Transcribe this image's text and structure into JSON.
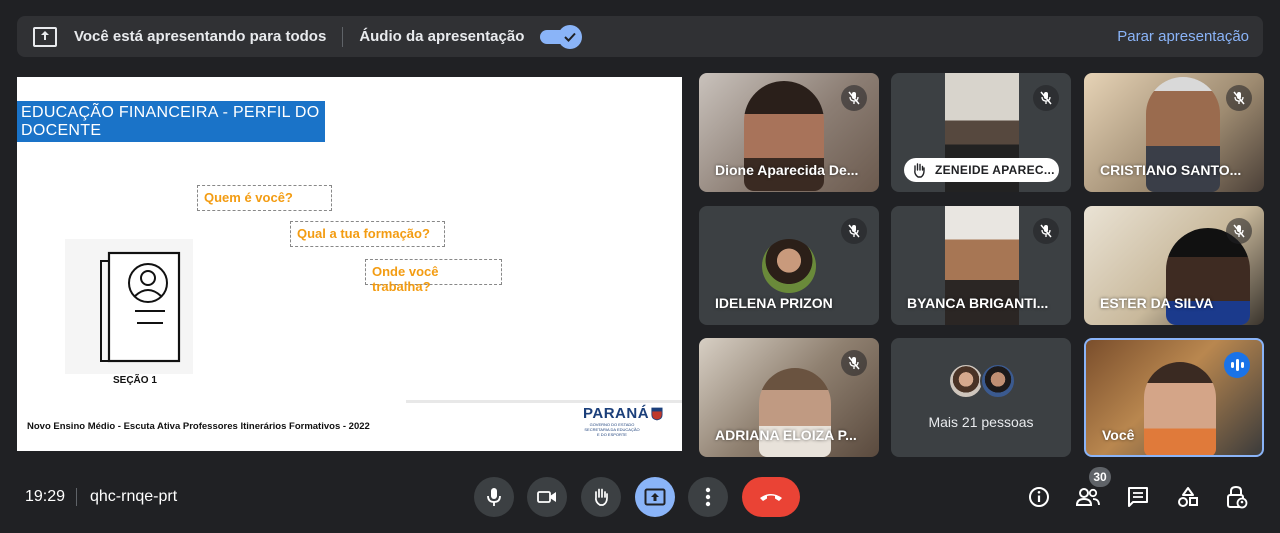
{
  "presenting_bar": {
    "message": "Você está apresentando para todos",
    "audio_label": "Áudio da apresentação",
    "audio_enabled": true,
    "stop_label": "Parar apresentação"
  },
  "slide": {
    "title": "EDUCAÇÃO FINANCEIRA  -  PERFIL DO DOCENTE",
    "questions": [
      "Quem é você?",
      "Qual a tua formação?",
      "Onde você trabalha?"
    ],
    "section": "SEÇÃO 1",
    "footer": "Novo Ensino Médio - Escuta Ativa Professores Itinerários Formativos - 2022",
    "logo_text": "PARANÁ",
    "logo_sub1": "GOVERNO DO ESTADO",
    "logo_sub2": "SECRETARIA DA EDUCAÇÃO E DO ESPORTE"
  },
  "participants": [
    {
      "name": "Dione Aparecida De...",
      "muted": true
    },
    {
      "name": "ZENEIDE APAREC...",
      "muted": true,
      "hand_raised": true
    },
    {
      "name": "CRISTIANO SANTO...",
      "muted": true
    },
    {
      "name": "IDELENA PRIZON",
      "muted": true
    },
    {
      "name": "BYANCA BRIGANTI...",
      "muted": true
    },
    {
      "name": "ESTER DA SILVA",
      "muted": true
    },
    {
      "name": "ADRIANA ELOIZA P...",
      "muted": true
    },
    {
      "name": "Mais 21 pessoas"
    },
    {
      "name": "Você",
      "speaking": true
    }
  ],
  "bottom_bar": {
    "time": "19:29",
    "meeting_code": "qhc-rnqe-prt",
    "participant_count": "30"
  },
  "colors": {
    "background": "#202124",
    "accent": "#8ab4f8",
    "end_call": "#ea4335",
    "slide_title_bg": "#1a73c8",
    "question_text": "#f39c12"
  }
}
